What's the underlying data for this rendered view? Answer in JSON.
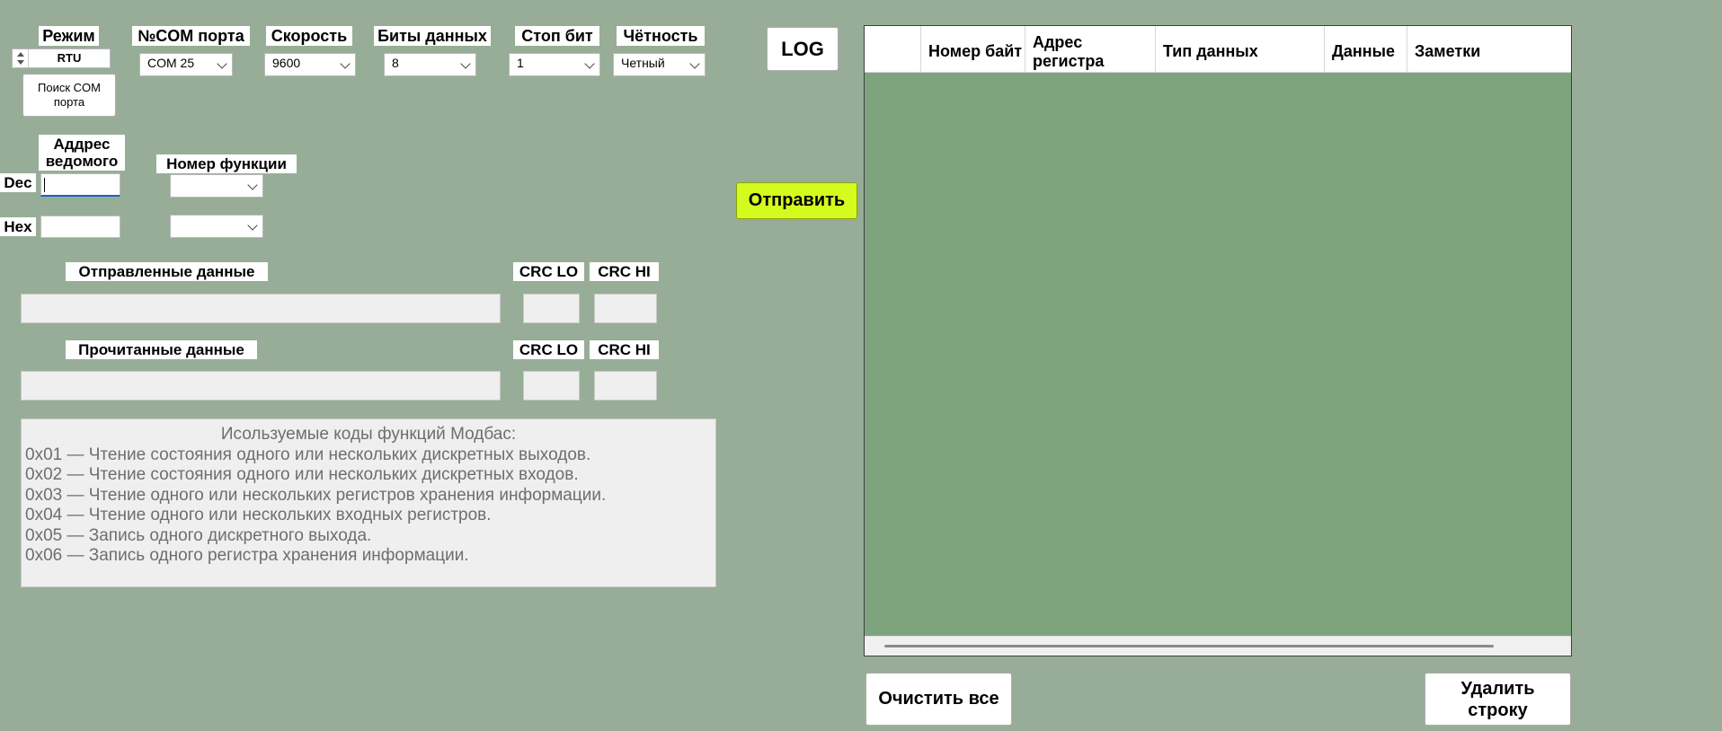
{
  "mode": {
    "label": "Режим",
    "value": "RTU"
  },
  "com_port": {
    "label": "№COM порта",
    "value": "COM 25"
  },
  "speed": {
    "label": "Скорость",
    "value": "9600"
  },
  "data_bits": {
    "label": "Биты данных",
    "value": "8"
  },
  "stop_bits": {
    "label": "Стоп бит",
    "value": "1"
  },
  "parity": {
    "label": "Чётность",
    "value": "Четный"
  },
  "search_com_button": "Поиск COM порта",
  "slave_address": {
    "label": "Аддрес ведомого",
    "dec_label": "Dec",
    "hex_label": "Hex",
    "dec_value": "",
    "hex_value": ""
  },
  "function_number": {
    "label": "Номер функции",
    "dec_value": "",
    "hex_value": ""
  },
  "sent_data": {
    "label": "Отправленные данные",
    "crc_lo": "CRC LO",
    "crc_hi": "CRC HI"
  },
  "read_data": {
    "label": "Прочитанные данные",
    "crc_lo": "CRC LO",
    "crc_hi": "CRC HI"
  },
  "info": {
    "title": "Исользуемые коды функций Модбас:",
    "lines": [
      "0x01 — Чтение состояния одного или нескольких дискретных выходов.",
      "0x02 — Чтение состояния одного или нескольких дискретных входов.",
      "0x03 — Чтение одного или нескольких регистров хранения информации.",
      "0x04 — Чтение одного или нескольких входных регистров.",
      "0x05 — Запись одного дискретного выхода.",
      "0x06 — Запись одного регистра хранения информации."
    ]
  },
  "log_button": "LOG",
  "send_button": "Отправить",
  "table": {
    "columns": [
      "",
      "Номер байт",
      "Адрес регистра",
      "Тип данных",
      "Данные",
      "Заметки"
    ]
  },
  "clear_all_button": "Очистить все",
  "delete_row_button": "Удалить строку",
  "colors": {
    "background": "#97ad97",
    "grid_background": "#7ea47e",
    "send_button": "#d4fb1e"
  },
  "icons": {
    "spinner": "up-down-spinner-icon",
    "dropdown": "chevron-down-icon"
  }
}
